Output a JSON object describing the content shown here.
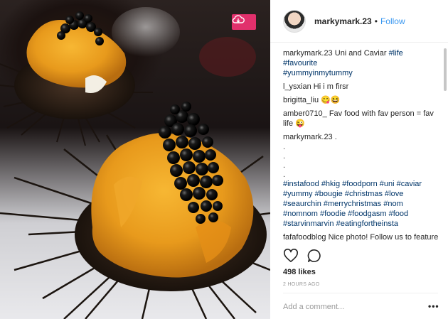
{
  "post": {
    "username": "markymark.23",
    "dot": "•",
    "follow_label": "Follow",
    "caption": {
      "user": "markymark.23",
      "text": " Uni and Caviar ",
      "tags_inline": "#life",
      "tags_after": [
        "#favourite",
        "#yummyinmytummy"
      ]
    },
    "comments": [
      {
        "user": "l_ysxian",
        "text": " Hi i m firsr"
      },
      {
        "user": "brigitta_liu",
        "text": " 😋😆"
      },
      {
        "user": "amber0710_",
        "text": " Fav food with fav person = fav life 😜"
      },
      {
        "user": "markymark.23",
        "text": " ."
      }
    ],
    "dots": [
      ".",
      ".",
      ".",
      "."
    ],
    "hashtags": "#instafood #hkig #foodporn #uni #caviar #yummy #bougie #christmas #love #seaurchin #merrychristmas #nom #nomnom #foodie #foodgasm #food #starvinmarvin #eatingfortheinsta",
    "last_comment": {
      "user": "fafafoodblog",
      "text": " Nice photo! Follow us to feature to our page too so thanks ! !!!!!"
    },
    "likes": "498 likes",
    "time": "2 HOURS AGO",
    "add_comment_placeholder": "Add a comment...",
    "more_label": "•••"
  },
  "icons": {
    "save": "cloud-save-icon",
    "like": "heart-icon",
    "comment": "speech-bubble-icon"
  },
  "colors": {
    "follow": "#3897f0",
    "hashtag": "#003569",
    "save_button": "#e1306c"
  }
}
